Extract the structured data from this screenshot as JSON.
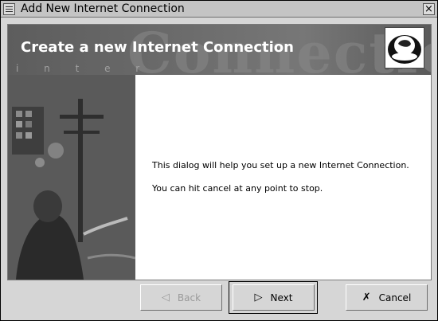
{
  "window": {
    "title": "Add New Internet Connection",
    "close_glyph": "×"
  },
  "banner": {
    "title": "Create a new Internet Connection",
    "watermark": "Connection",
    "dots": "i n t e r"
  },
  "content": {
    "line1": "This dialog will help you set up a new Internet Connection.",
    "line2": "You can hit cancel at any point to stop."
  },
  "buttons": {
    "back": {
      "label": "Back",
      "icon": "back-arrow-icon",
      "enabled": false
    },
    "next": {
      "label": "Next",
      "icon": "next-arrow-icon",
      "enabled": true,
      "default": true
    },
    "cancel": {
      "label": "Cancel",
      "icon": "cancel-x-icon",
      "enabled": true
    }
  },
  "colors": {
    "banner_bg": "#6b6b6b",
    "dialog_bg": "#d6d6d6",
    "content_bg": "#ffffff",
    "disabled_text": "#9a9a9a"
  }
}
